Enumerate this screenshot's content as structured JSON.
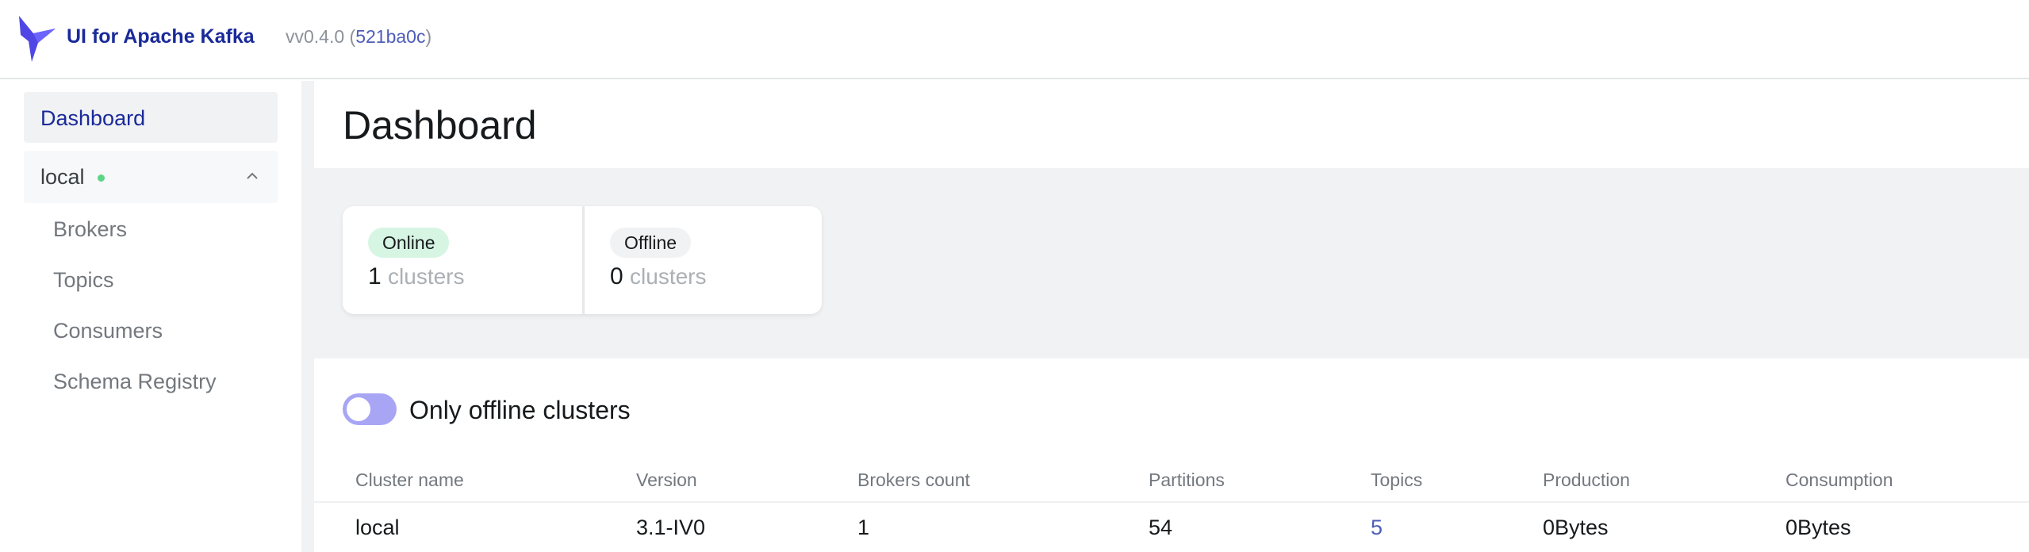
{
  "header": {
    "app_title": "UI for Apache Kafka",
    "version_prefix": "vv0.4.0 (",
    "commit": "521ba0c",
    "version_suffix": ")",
    "logo_color": "#4f46e5"
  },
  "sidebar": {
    "dashboard": "Dashboard",
    "cluster": {
      "name": "local",
      "status_color": "#5cd685"
    },
    "items": [
      "Brokers",
      "Topics",
      "Consumers",
      "Schema Registry"
    ]
  },
  "main": {
    "title": "Dashboard",
    "stats": [
      {
        "badge": "Online",
        "count": "1",
        "unit": "clusters"
      },
      {
        "badge": "Offline",
        "count": "0",
        "unit": "clusters"
      }
    ],
    "toggle": {
      "label": "Only offline clusters",
      "checked": false
    },
    "table": {
      "columns": [
        "Cluster name",
        "Version",
        "Brokers count",
        "Partitions",
        "Topics",
        "Production",
        "Consumption"
      ],
      "rows": [
        [
          "local",
          "3.1-IV0",
          "1",
          "54",
          "5",
          "0Bytes",
          "0Bytes"
        ]
      ]
    }
  }
}
